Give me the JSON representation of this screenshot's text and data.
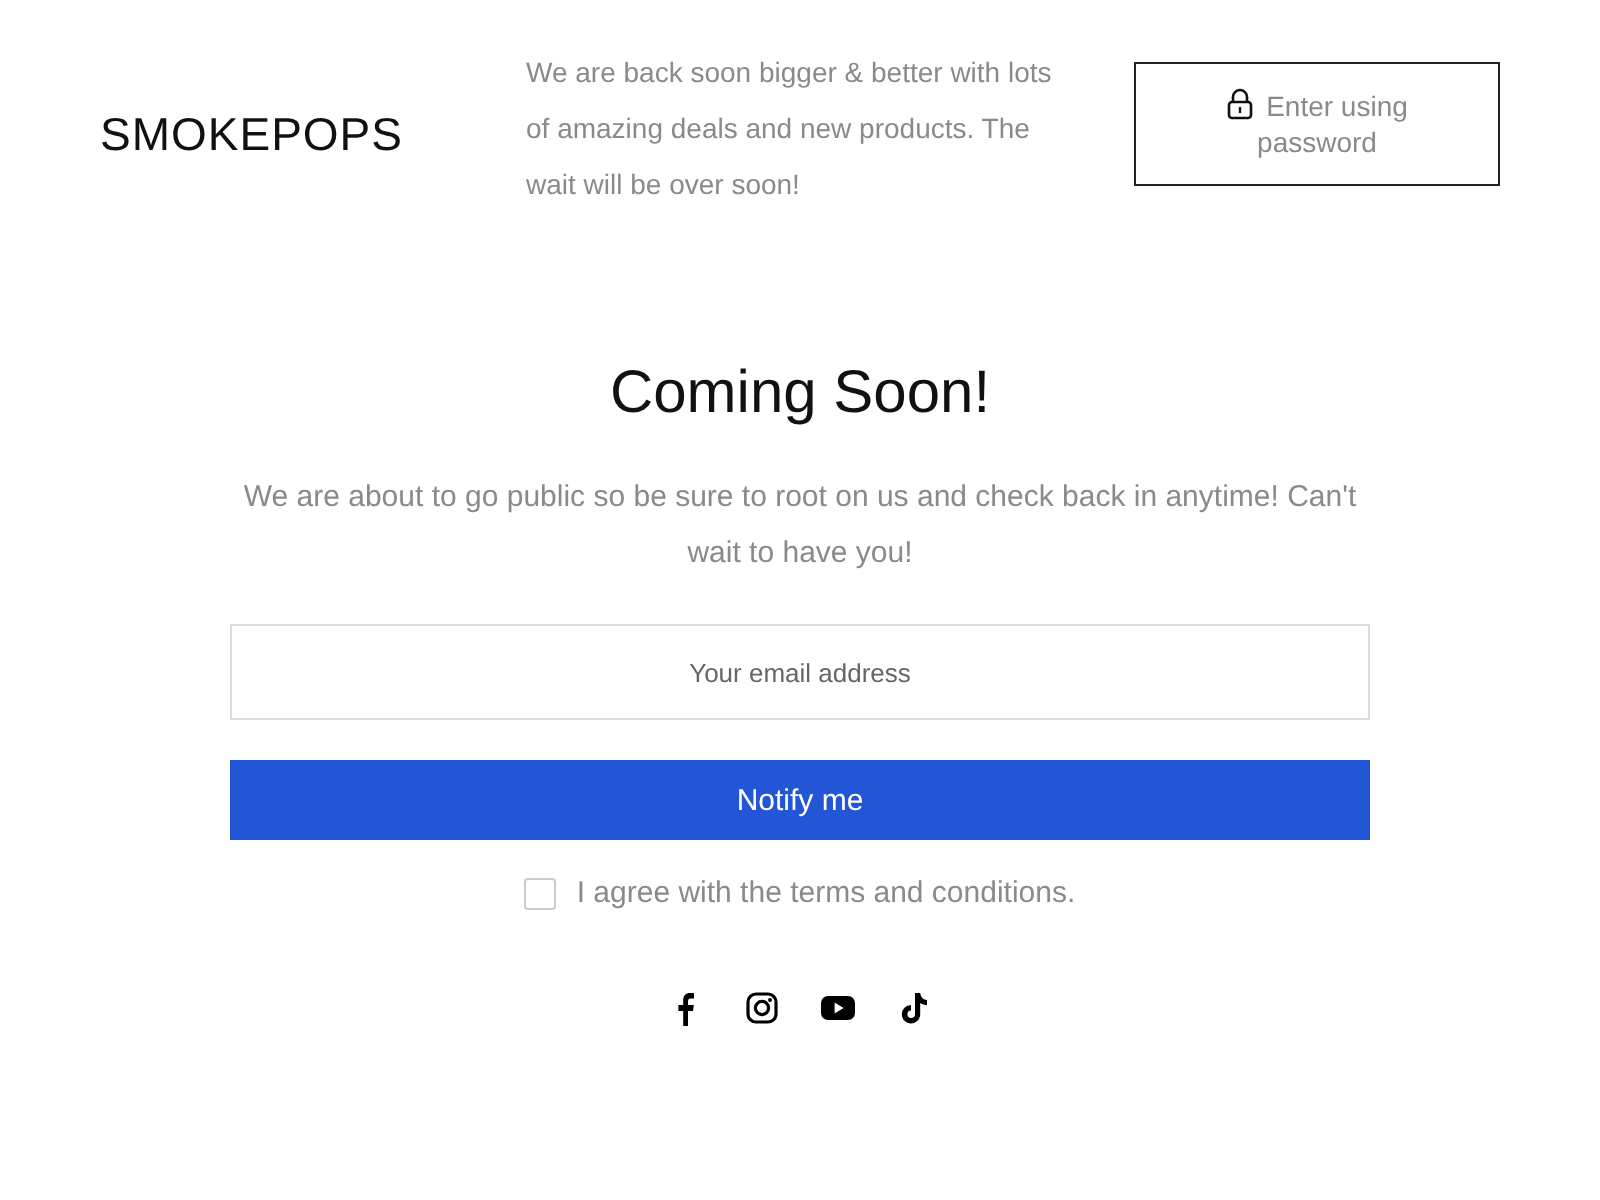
{
  "header": {
    "logo": "SMOKEPOPS",
    "message": "We are back soon bigger & better with lots of amazing deals and new products. The wait will be over soon!",
    "password_button": "Enter using password"
  },
  "main": {
    "title": "Coming Soon!",
    "description": "We are about to go public so be sure to root on us and check back in anytime! Can't wait to have you!",
    "email": {
      "placeholder": "Your email address"
    },
    "submit": "Notify me",
    "terms": {
      "label": "I agree with the terms and conditions.",
      "checked": false
    }
  },
  "social": [
    {
      "kind": "facebook"
    },
    {
      "kind": "instagram"
    },
    {
      "kind": "youtube"
    },
    {
      "kind": "tiktok"
    }
  ]
}
